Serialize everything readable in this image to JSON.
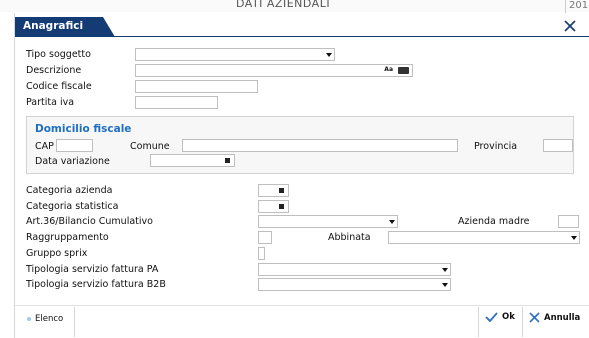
{
  "background": {
    "window_title": "DATI AZIENDALI",
    "right_text": "201"
  },
  "dialog": {
    "title": "Anagrafici"
  },
  "form": {
    "tipo_soggetto": {
      "label": "Tipo soggetto",
      "value": ""
    },
    "descrizione": {
      "label": "Descrizione",
      "value": "",
      "aa_label": "Aa"
    },
    "codice_fiscale": {
      "label": "Codice fiscale",
      "value": ""
    },
    "partita_iva": {
      "label": "Partita iva",
      "value": ""
    }
  },
  "domicilio": {
    "title": "Domicilio fiscale",
    "cap_label": "CAP",
    "comune_label": "Comune",
    "provincia_label": "Provincia",
    "data_variazione_label": "Data variazione"
  },
  "fields": {
    "categoria_azienda": "Categoria azienda",
    "categoria_statistica": "Categoria statistica",
    "art36": "Art.36/Bilancio Cumulativo",
    "azienda_madre": "Azienda madre",
    "raggruppamento": "Raggruppamento",
    "abbinata": "Abbinata",
    "gruppo_sprix": "Gruppo sprix",
    "tipologia_pa": "Tipologia servizio fattura PA",
    "tipologia_b2b": "Tipologia servizio fattura B2B"
  },
  "footer": {
    "elenco_label": "Elenco",
    "ok_label": "Ok",
    "annulla_label": "Annulla"
  },
  "colors": {
    "title_bar": "#143b73",
    "group_title": "#1f6fc0"
  }
}
